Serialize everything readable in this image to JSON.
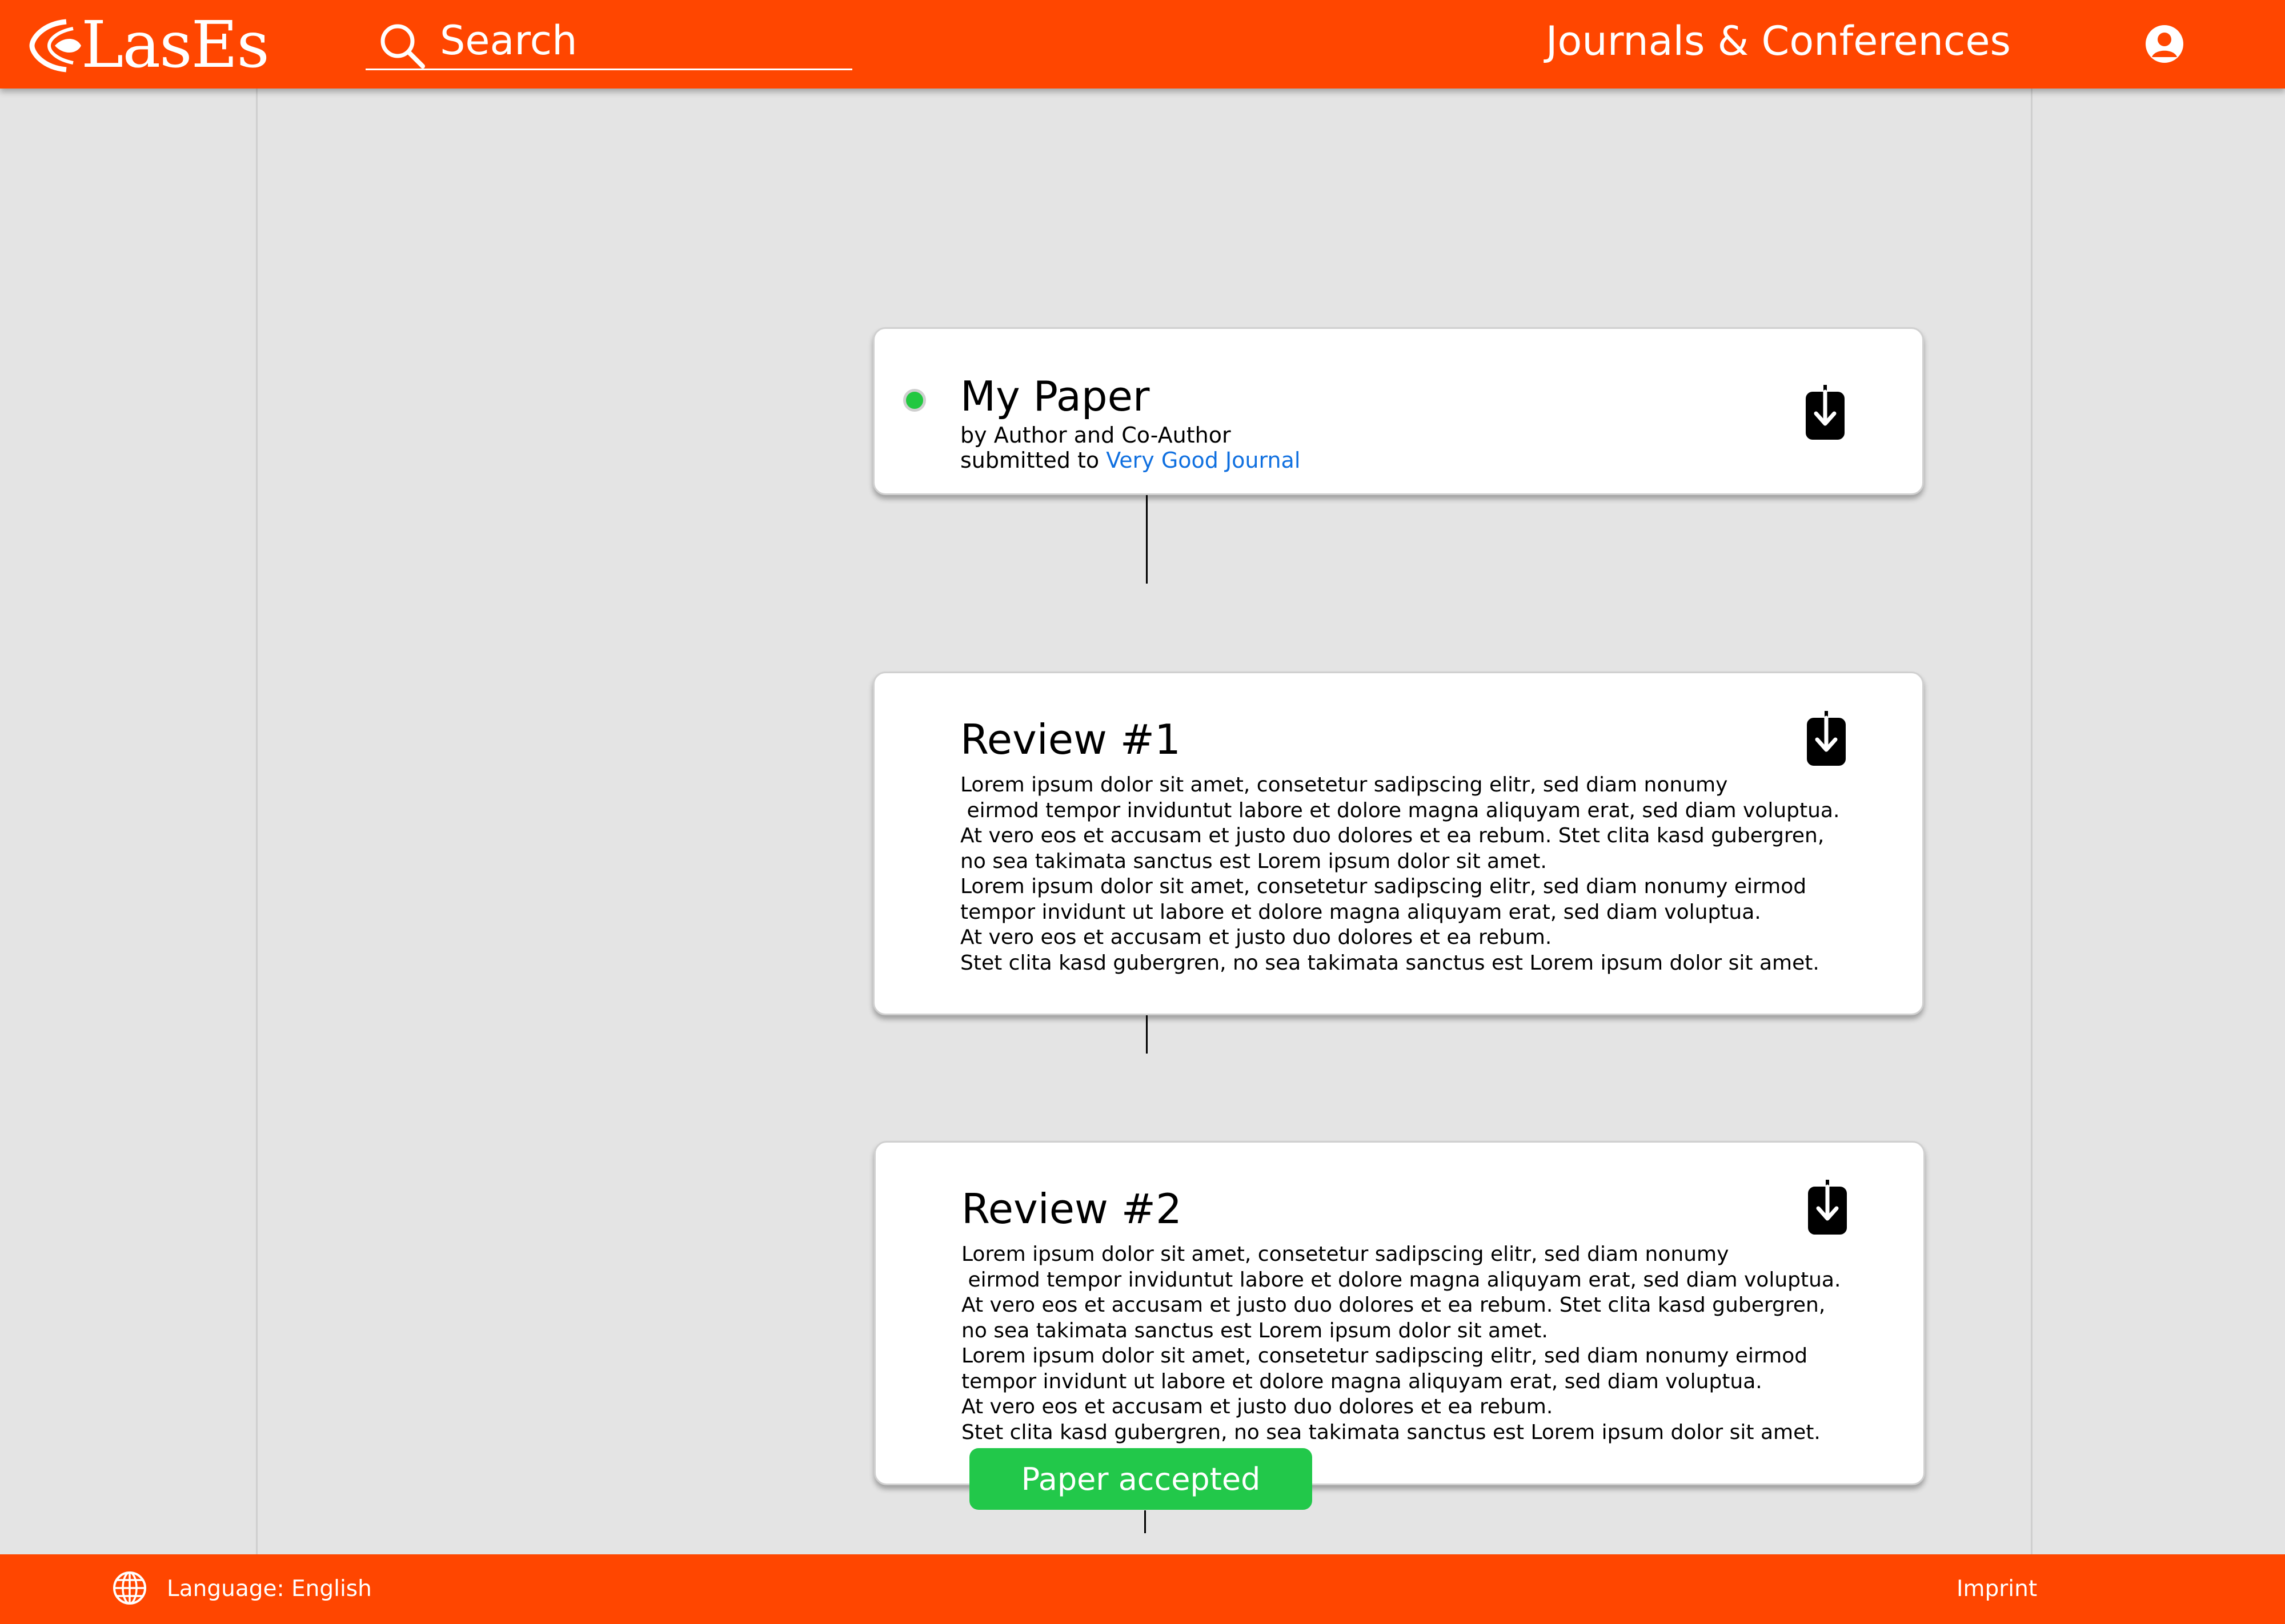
{
  "header": {
    "logo_text": "LasEs",
    "search": {
      "placeholder": "Search"
    },
    "nav_link": "Journals & Conferences"
  },
  "paper": {
    "title": "My Paper",
    "by_line": "by Author and Co-Author",
    "submitted_prefix": "submitted to",
    "journal": "Very Good Journal",
    "status_color": "#22c840"
  },
  "reviews": [
    {
      "title": "Review #1",
      "body": "Lorem ipsum dolor sit amet, consetetur sadipscing elitr, sed diam nonumy\n eirmod tempor inviduntut labore et dolore magna aliquyam erat, sed diam voluptua.\nAt vero eos et accusam et justo duo dolores et ea rebum. Stet clita kasd gubergren,\nno sea takimata sanctus est Lorem ipsum dolor sit amet.\nLorem ipsum dolor sit amet, consetetur sadipscing elitr, sed diam nonumy eirmod\ntempor invidunt ut labore et dolore magna aliquyam erat, sed diam voluptua.\nAt vero eos et accusam et justo duo dolores et ea rebum.\nStet clita kasd gubergren, no sea takimata sanctus est Lorem ipsum dolor sit amet."
    },
    {
      "title": "Review #2",
      "body": "Lorem ipsum dolor sit amet, consetetur sadipscing elitr, sed diam nonumy\n eirmod tempor inviduntut labore et dolore magna aliquyam erat, sed diam voluptua.\nAt vero eos et accusam et justo duo dolores et ea rebum. Stet clita kasd gubergren,\nno sea takimata sanctus est Lorem ipsum dolor sit amet.\nLorem ipsum dolor sit amet, consetetur sadipscing elitr, sed diam nonumy eirmod\ntempor invidunt ut labore et dolore magna aliquyam erat, sed diam voluptua.\nAt vero eos et accusam et justo duo dolores et ea rebum.\nStet clita kasd gubergren, no sea takimata sanctus est Lorem ipsum dolor sit amet."
    }
  ],
  "status_badge": {
    "label": "Paper accepted",
    "color": "#22c84a"
  },
  "footer": {
    "language": "Language: English",
    "imprint": "Imprint"
  },
  "icons": {
    "logo": "eye-logo-icon",
    "search": "search-icon",
    "profile": "user-profile-icon",
    "download": "download-icon",
    "language": "globe-icon"
  },
  "colors": {
    "brand": "#ff4600",
    "background": "#e4e4e4",
    "link": "#1070e0"
  }
}
